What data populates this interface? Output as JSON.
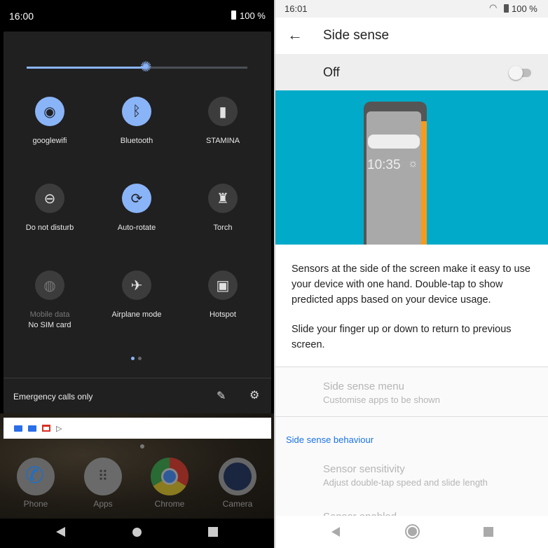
{
  "left": {
    "status": {
      "time": "16:00",
      "battery": "100 %"
    },
    "brightness": {
      "level": 0.54
    },
    "tiles": [
      {
        "label": "googlewifi",
        "icon": "wifi-icon",
        "active": true
      },
      {
        "label": "Bluetooth",
        "icon": "bluetooth-icon",
        "active": true
      },
      {
        "label": "STAMINA",
        "icon": "battery-icon",
        "active": false
      },
      {
        "label": "Do not disturb",
        "icon": "do-not-disturb-icon",
        "active": false
      },
      {
        "label": "Auto-rotate",
        "icon": "auto-rotate-icon",
        "active": true
      },
      {
        "label": "Torch",
        "icon": "torch-icon",
        "active": false
      },
      {
        "label": "Mobile data",
        "sublabel": "No SIM card",
        "icon": "mobile-data-icon",
        "active": false,
        "disabled": true
      },
      {
        "label": "Airplane mode",
        "icon": "airplane-icon",
        "active": false
      },
      {
        "label": "Hotspot",
        "icon": "hotspot-icon",
        "active": false
      }
    ],
    "footer": {
      "text": "Emergency calls only"
    },
    "notification_icons": [
      "google-calendar-icon",
      "google-calendar-icon",
      "gmail-icon",
      "play-store-icon"
    ],
    "dock": [
      {
        "label": "Phone"
      },
      {
        "label": "Apps"
      },
      {
        "label": "Chrome"
      },
      {
        "label": "Camera"
      }
    ]
  },
  "right": {
    "status": {
      "time": "16:01",
      "battery": "100 %"
    },
    "title": "Side sense",
    "master": {
      "label": "Off",
      "enabled": false
    },
    "illustration": {
      "clock": "10:35",
      "bg": "#00aac8",
      "accent": "#f59b1e"
    },
    "description1": "Sensors at the side of the screen make it easy to use your device with one hand. Double-tap to show predicted apps based on your device usage.",
    "description2": "Slide your finger up or down to return to previous screen.",
    "menu": {
      "title": "Side sense menu",
      "subtitle": "Customise apps to be shown"
    },
    "section": "Side sense behaviour",
    "sensitivity": {
      "title": "Sensor sensitivity",
      "subtitle": "Adjust double-tap speed and slide length"
    },
    "enabled": {
      "title": "Sensor enabled"
    },
    "accent": "#1a73e8"
  }
}
